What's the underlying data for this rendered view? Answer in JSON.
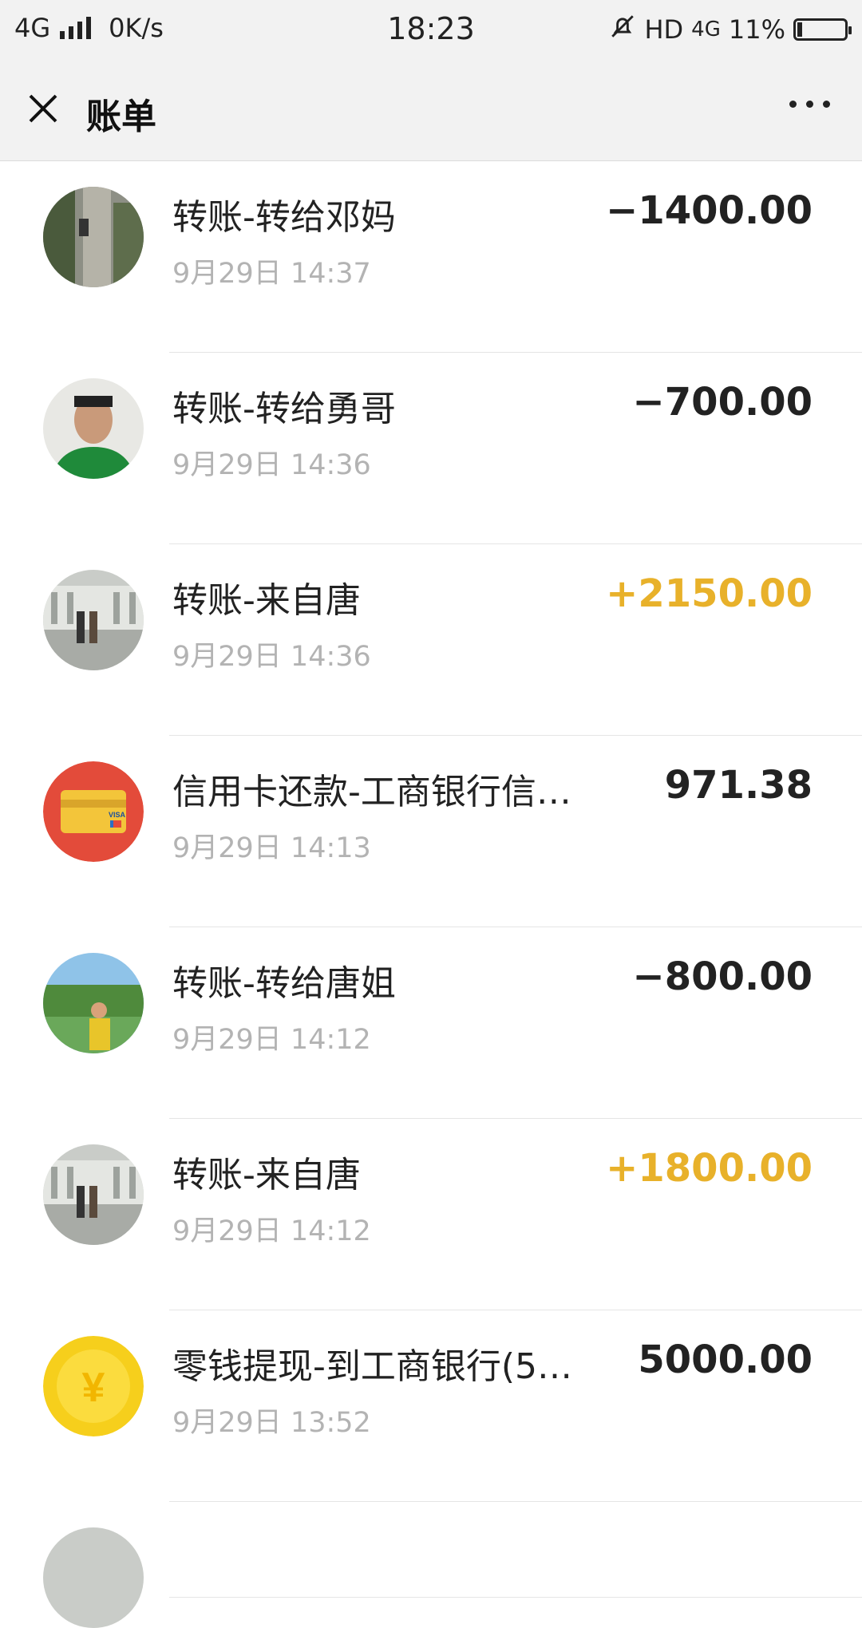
{
  "status_bar": {
    "network": "4G",
    "speed": "0K/s",
    "time": "18:23",
    "hd": "HD",
    "network_right": "4G",
    "battery": "11%",
    "battery_level": 0.11
  },
  "nav": {
    "close_icon": "close-icon",
    "title": "账单",
    "more_icon": "more-icon"
  },
  "colors": {
    "income": "#e8b12a",
    "expense": "#222222",
    "time_gray": "#b3b3b3"
  },
  "transactions": [
    {
      "title": "转账-转给邓妈",
      "time": "9月29日 14:37",
      "amount": "−1400.00",
      "type": "expense",
      "avatar": "photo-tree"
    },
    {
      "title": "转账-转给勇哥",
      "time": "9月29日 14:36",
      "amount": "−700.00",
      "type": "expense",
      "avatar": "photo-man-green"
    },
    {
      "title": "转账-来自唐",
      "time": "9月29日 14:36",
      "amount": "+2150.00",
      "type": "income",
      "avatar": "photo-building"
    },
    {
      "title": "信用卡还款-工商银行信…",
      "time": "9月29日 14:13",
      "amount": "971.38",
      "type": "neutral",
      "avatar": "credit-card-icon"
    },
    {
      "title": "转账-转给唐姐",
      "time": "9月29日 14:12",
      "amount": "−800.00",
      "type": "expense",
      "avatar": "photo-garden"
    },
    {
      "title": "转账-来自唐",
      "time": "9月29日 14:12",
      "amount": "+1800.00",
      "type": "income",
      "avatar": "photo-building"
    },
    {
      "title": "零钱提现-到工商银行(5…",
      "time": "9月29日 13:52",
      "amount": "5000.00",
      "type": "neutral",
      "avatar": "yuan-coin-icon"
    }
  ]
}
